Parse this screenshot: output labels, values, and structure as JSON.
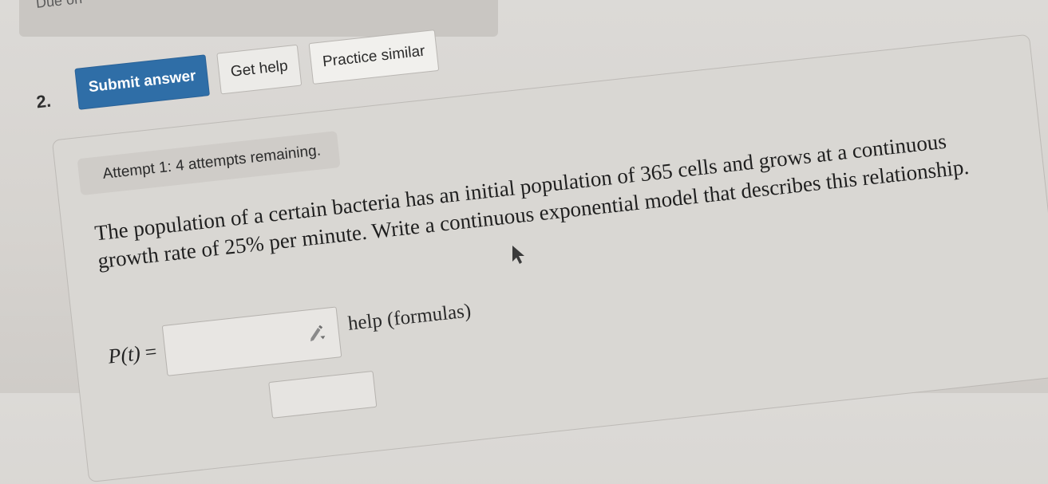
{
  "header": {
    "due_text": "Due on"
  },
  "question": {
    "number": "2.",
    "buttons": {
      "submit": "Submit answer",
      "get_help": "Get help",
      "practice_similar": "Practice similar"
    },
    "attempt_text": "Attempt 1: 4 attempts remaining.",
    "prompt": "The population of a certain bacteria has an initial population of 365 cells and grows at a continuous growth rate of 25% per minute. Write a continuous exponential model that describes this relationship.",
    "answer": {
      "label": "P(t)",
      "equals": "=",
      "value": "",
      "help_link": "help (formulas)"
    }
  },
  "icons": {
    "pencil": "pencil-dropdown-icon",
    "cursor": "mouse-pointer-icon"
  },
  "colors": {
    "primary_button": "#2f6ea7",
    "background": "#d9d7d3"
  }
}
